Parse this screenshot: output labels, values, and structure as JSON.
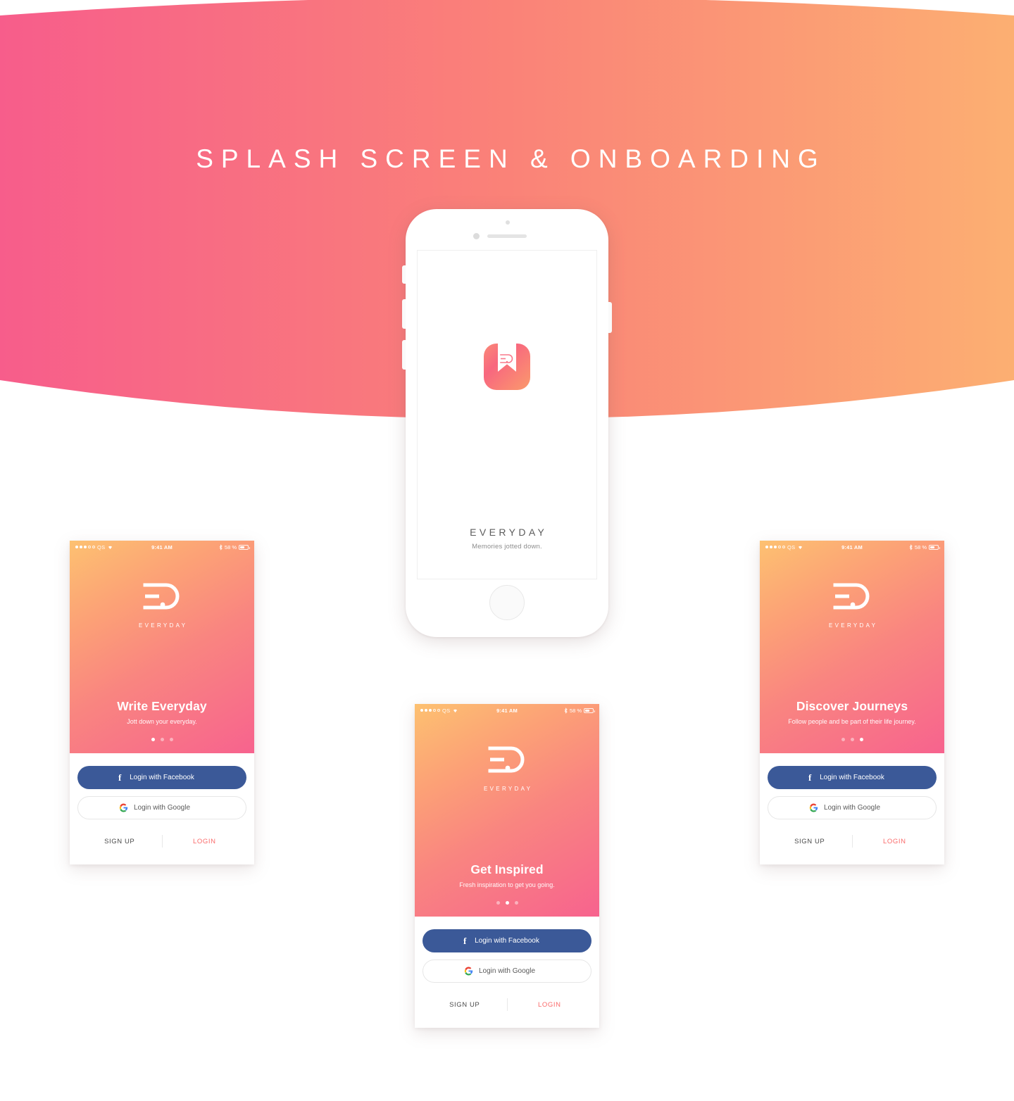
{
  "hero": {
    "title": "SPLASH SCREEN & ONBOARDING",
    "gradient_from": "#f75d8b",
    "gradient_to": "#fcaf72"
  },
  "splash": {
    "app_icon_name": "everyday-bookmark-icon",
    "wordmark": "EVERYDAY",
    "tagline": "Memories jotted down."
  },
  "statusbar": {
    "carrier": "QS",
    "time": "9:41 AM",
    "battery_percent": "58 %",
    "wifi_icon": "wifi-icon",
    "bluetooth_icon": "bluetooth-icon",
    "battery_icon": "battery-icon"
  },
  "auth": {
    "facebook_label": "Login with Facebook",
    "google_label": "Login with Google",
    "signup_label": "SIGN UP",
    "login_label": "LOGIN",
    "facebook_color": "#3b5998",
    "login_color": "#fa6a6a"
  },
  "brand": {
    "logo_mark": "E.D",
    "wordmark": "EVERYDAY"
  },
  "onboarding": [
    {
      "id": "write-everyday",
      "headline": "Write Everyday",
      "subtitle": "Jott down your everyday.",
      "active_dot": 0
    },
    {
      "id": "get-inspired",
      "headline": "Get Inspired",
      "subtitle": "Fresh inspiration to get you going.",
      "active_dot": 1
    },
    {
      "id": "discover-journeys",
      "headline": "Discover Journeys",
      "subtitle": "Follow people and be part of their life journey.",
      "active_dot": 2
    }
  ]
}
